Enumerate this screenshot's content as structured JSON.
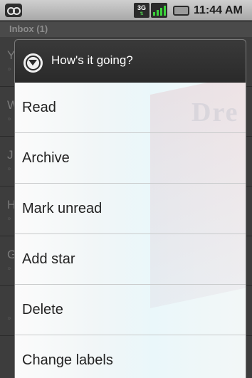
{
  "status_bar": {
    "network_label": "3G",
    "time": "11:44 AM",
    "icons": [
      "voicemail-icon",
      "network-3g-icon",
      "signal-icon",
      "battery-icon"
    ]
  },
  "inbox": {
    "header": "Inbox (1)",
    "rows": [
      {
        "letter": "Y",
        "mark": "»"
      },
      {
        "letter": "W",
        "mark": "»"
      },
      {
        "letter": "J",
        "mark": "»"
      },
      {
        "letter": "H",
        "mark": "»"
      },
      {
        "letter": "G",
        "mark": "»"
      },
      {
        "letter": "",
        "mark": "»"
      }
    ]
  },
  "dialog": {
    "title": "How's it going?",
    "icon": "expand-circle-icon",
    "items": [
      {
        "label": "Read"
      },
      {
        "label": "Archive"
      },
      {
        "label": "Mark unread"
      },
      {
        "label": "Add star"
      },
      {
        "label": "Delete"
      },
      {
        "label": "Change labels"
      }
    ]
  },
  "watermark_text": "Dre",
  "colors": {
    "status_bar": "#b9b9b9",
    "dialog_header": "#333333",
    "menu_bg": "#f2f7f8",
    "signal_green": "#3bd33b"
  }
}
